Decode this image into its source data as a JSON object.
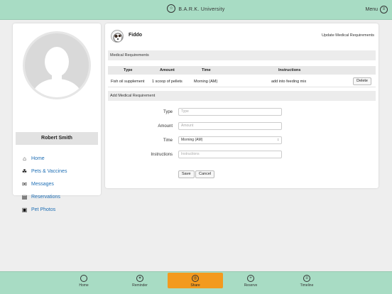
{
  "header": {
    "title": "B.A.R.K. University",
    "menu_label": "Menu"
  },
  "profile": {
    "name": "Robert Smith"
  },
  "nav": [
    {
      "label": "Home",
      "icon": "home-icon"
    },
    {
      "label": "Pets & Vaccines",
      "icon": "paw-icon"
    },
    {
      "label": "Messages",
      "icon": "envelope-icon"
    },
    {
      "label": "Reservations",
      "icon": "calendar-icon"
    },
    {
      "label": "Pet Photos",
      "icon": "photos-icon"
    }
  ],
  "pet": {
    "name": "Fiddo",
    "update_link": "Update Medical Requirements"
  },
  "medical": {
    "section_title": "Medical Requirements",
    "columns": [
      "Type",
      "Amount",
      "Time",
      "Instructions"
    ],
    "rows": [
      {
        "type": "Fish oil supplement",
        "amount": "1 scoop of pellets",
        "time": "Morning (AM)",
        "instructions": "add into feeding mix",
        "action": "Delete"
      }
    ]
  },
  "add_form": {
    "section_title": "Add Medical Requirement",
    "type_label": "Type",
    "type_placeholder": "Type",
    "amount_label": "Amount",
    "amount_placeholder": "Amount",
    "time_label": "Time",
    "time_value": "Morning (AM)",
    "instructions_label": "Instructions",
    "instructions_placeholder": "Instructions",
    "save_label": "Save",
    "cancel_label": "Cancel"
  },
  "tabs": [
    {
      "label": "Home",
      "icon": "home-circle-icon",
      "active": false
    },
    {
      "label": "Reminder",
      "icon": "reminder-icon",
      "active": false
    },
    {
      "label": "Share",
      "icon": "share-icon",
      "active": true
    },
    {
      "label": "Reserve",
      "icon": "plus-circle-icon",
      "active": false
    },
    {
      "label": "Timeline",
      "icon": "timeline-icon",
      "active": false
    }
  ],
  "colors": {
    "header_bg": "#a8dcc4",
    "active_tab": "#f39a1e",
    "link": "#1f6fb5"
  }
}
